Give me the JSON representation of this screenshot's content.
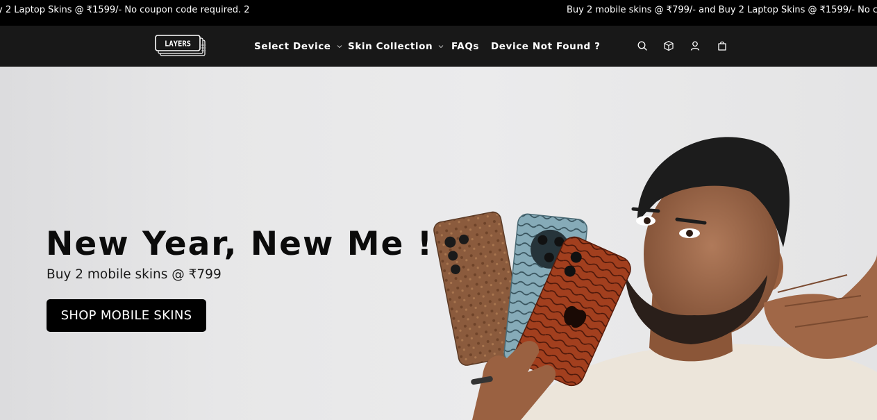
{
  "announcement": {
    "text_left": "y 2 Laptop Skins @ ₹1599/- No coupon code required. 2",
    "text_right": "Buy 2 mobile skins @ ₹799/- and Buy 2 Laptop Skins @ ₹1599/- No coupon"
  },
  "brand": {
    "logo_text": "LAYERS"
  },
  "nav": {
    "items": [
      {
        "label": "Select Device",
        "has_dropdown": true
      },
      {
        "label": "Skin Collection",
        "has_dropdown": true
      },
      {
        "label": "FAQs",
        "has_dropdown": false
      },
      {
        "label": "Device Not Found ?",
        "has_dropdown": false
      }
    ]
  },
  "header_icons": [
    "search-icon",
    "box-icon",
    "account-icon",
    "cart-icon"
  ],
  "hero": {
    "title": "New Year, New Me !",
    "subtitle": "Buy 2 mobile skins @ ₹799",
    "cta_label": "SHOP MOBILE SKINS"
  },
  "colors": {
    "announcement_bg": "#000000",
    "header_bg": "#181818",
    "hero_bg": "#e9e9ea",
    "cta_bg": "#000000",
    "skin_wood": "#8a5a3c",
    "skin_blue": "#7fa3b0",
    "skin_red": "#9c3a1c"
  }
}
